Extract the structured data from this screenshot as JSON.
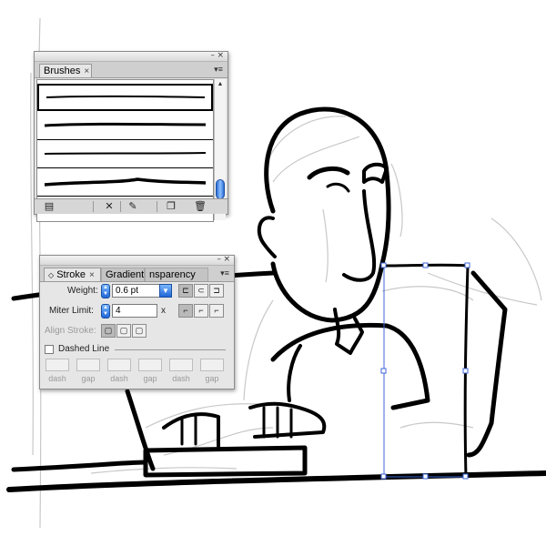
{
  "brushes_panel": {
    "tab_label": "Brushes",
    "close_glyph": "×",
    "minimize_glyph": "–",
    "window_close_glyph": "×",
    "menu_glyph": "▾≡",
    "icons": [
      "brush-libraries-menu-icon",
      "remove-brush-stroke-icon",
      "brush-options-icon",
      "new-brush-icon",
      "delete-brush-icon"
    ]
  },
  "stroke_panel": {
    "tabs": [
      {
        "label": "Stroke",
        "active": true
      },
      {
        "label": "Gradient",
        "active": false
      },
      {
        "label": "nsparency",
        "active": false
      }
    ],
    "close_glyph": "×",
    "tab_prefix_glyph": "◇",
    "minimize_glyph": "–",
    "window_close_glyph": "×",
    "menu_glyph": "▾≡",
    "weight_label": "Weight:",
    "weight_value": "0.6 pt",
    "miter_label": "Miter Limit:",
    "miter_value": "4",
    "miter_unit": "x",
    "align_label": "Align Stroke:",
    "dashed_label": "Dashed Line",
    "dashed_checked": false,
    "dash_fields": [
      "dash",
      "gap",
      "dash",
      "gap",
      "dash",
      "gap"
    ]
  },
  "colors": {
    "selection": "#3c66d8",
    "ink": "#000000",
    "sketch": "#c8c8c8"
  }
}
